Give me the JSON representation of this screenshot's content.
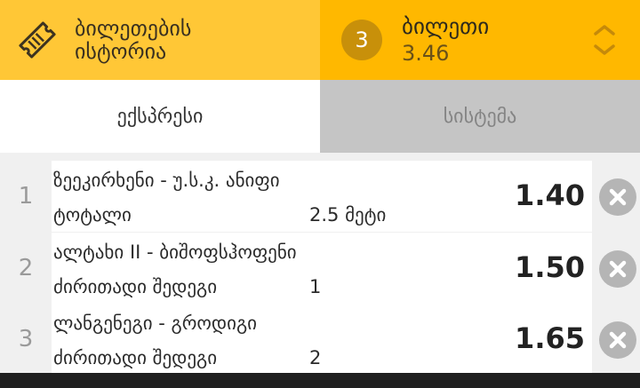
{
  "header": {
    "history_line1": "ბილეთების",
    "history_line2": "ისტორია",
    "ticket_count": "3",
    "ticket_title": "ბილეთი",
    "ticket_odds": "3.46"
  },
  "tabs": [
    {
      "label": "ექსპრესი",
      "active": true
    },
    {
      "label": "სისტემა",
      "active": false
    }
  ],
  "bets": [
    {
      "index": "1",
      "match": "ზეეკირხენი - უ.ს.კ. ანიფი",
      "market": "ტოტალი",
      "selection": "2.5 მეტი",
      "odds": "1.40"
    },
    {
      "index": "2",
      "match": "ალტახი II - ბიშოფსჰოფენი",
      "market": "ძირითადი შედეგი",
      "selection": "1",
      "odds": "1.50"
    },
    {
      "index": "3",
      "match": "ლანგენეგი - გროდიგი",
      "market": "ძირითადი შედეგი",
      "selection": "2",
      "odds": "1.65"
    }
  ],
  "icons": {
    "history": "ticket-icon",
    "collapse": "chevron-up-down-icon",
    "remove": "close-circle-icon"
  },
  "colors": {
    "history_bg": "#ffc736",
    "ticket_bg": "#ffb800",
    "badge_bg": "#c8900a",
    "inactive_tab": "#c5c5c5",
    "remove_circle": "#b5b5b5"
  }
}
